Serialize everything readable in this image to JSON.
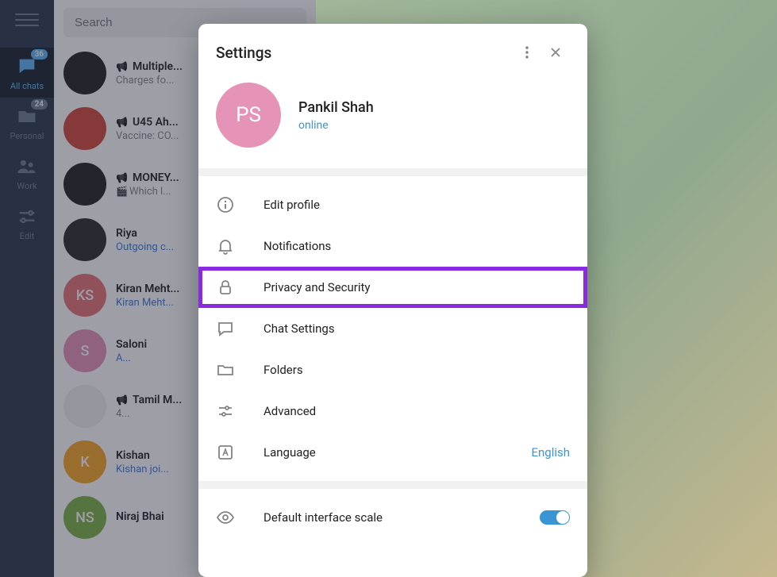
{
  "sidebar": {
    "tabs": [
      {
        "label": "All chats",
        "badge": "36",
        "icon": "chat"
      },
      {
        "label": "Personal",
        "badge": "24",
        "icon": "folder"
      },
      {
        "label": "Work",
        "badge": null,
        "icon": "people"
      },
      {
        "label": "Edit",
        "badge": null,
        "icon": "sliders"
      }
    ]
  },
  "search": {
    "placeholder": "Search"
  },
  "chats": [
    {
      "title": "Multiple...",
      "preview": "Charges fo...",
      "avatar_bg": "#222",
      "channel": true
    },
    {
      "title": "U45 Ah...",
      "preview": "Vaccine: CO...",
      "avatar_bg": "#d14836",
      "channel": true
    },
    {
      "title": "MONEY...",
      "preview": "Which l...",
      "avatar_bg": "#222",
      "channel": true,
      "clip": true
    },
    {
      "title": "Riya",
      "preview": "Outgoing c...",
      "avatar_bg": "#2b2b2b",
      "link": true
    },
    {
      "title": "Kiran Meht...",
      "preview": "Kiran Meht...",
      "avatar_bg": "#e57373",
      "initials": "KS",
      "link": true
    },
    {
      "title": "Saloni",
      "preview": "A...",
      "avatar_bg": "#e693b8",
      "initials": "S",
      "link": true
    },
    {
      "title": "Tamil M...",
      "preview": "4...",
      "avatar_bg": "#eee",
      "channel": true
    },
    {
      "title": "Kishan",
      "preview": "Kishan joi...",
      "avatar_bg": "#f5a623",
      "initials": "K",
      "link": true
    },
    {
      "title": "Niraj Bhai",
      "preview": "",
      "avatar_bg": "#7cb342",
      "initials": "NS"
    }
  ],
  "main": {
    "chip": "messaging"
  },
  "settings": {
    "title": "Settings",
    "profile": {
      "initials": "PS",
      "name": "Pankil Shah",
      "status": "online"
    },
    "menu": [
      {
        "id": "edit-profile",
        "label": "Edit profile",
        "icon": "info"
      },
      {
        "id": "notifications",
        "label": "Notifications",
        "icon": "bell"
      },
      {
        "id": "privacy",
        "label": "Privacy and Security",
        "icon": "lock",
        "highlight": true
      },
      {
        "id": "chat-settings",
        "label": "Chat Settings",
        "icon": "chat"
      },
      {
        "id": "folders",
        "label": "Folders",
        "icon": "folder"
      },
      {
        "id": "advanced",
        "label": "Advanced",
        "icon": "sliders"
      },
      {
        "id": "language",
        "label": "Language",
        "icon": "lang",
        "value": "English"
      }
    ],
    "scale_row": {
      "label": "Default interface scale",
      "icon": "eye",
      "toggle": true
    }
  }
}
